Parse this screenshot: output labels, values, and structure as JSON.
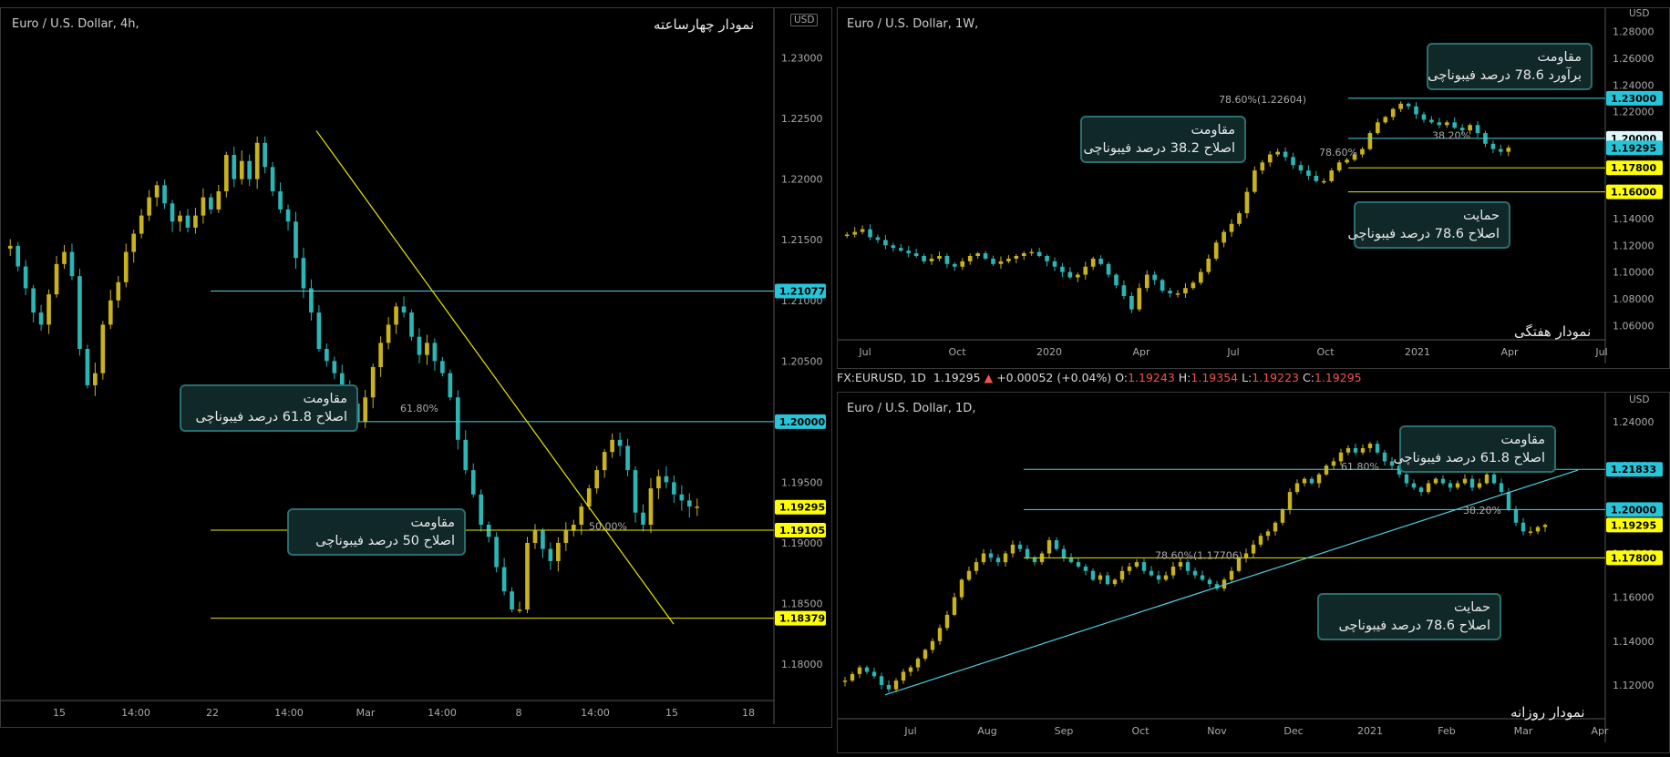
{
  "panels": {
    "left": {
      "title": "Euro / U.S. Dollar, 4h,",
      "fa_title": "نمودار چهارساعته",
      "currency": "USD",
      "y_ticks": [
        "1.23000",
        "1.22500",
        "1.22000",
        "1.21500",
        "1.21000",
        "1.20500",
        "1.20000",
        "1.19500",
        "1.19000",
        "1.18500",
        "1.18000"
      ],
      "x_ticks": [
        "15",
        "14:00",
        "22",
        "14:00",
        "Mar",
        "14:00",
        "8",
        "14:00",
        "15",
        "18"
      ],
      "price_boxes": [
        {
          "label": "1.21077",
          "bg": "#26c6da",
          "fg": "#000000"
        },
        {
          "label": "1.20000",
          "bg": "#26c6da",
          "fg": "#000000"
        },
        {
          "label": "1.19295",
          "bg": "#ffff00",
          "fg": "#000000"
        },
        {
          "label": "1.19105",
          "bg": "#ffff00",
          "fg": "#000000"
        },
        {
          "label": "1.18379",
          "bg": "#ffff00",
          "fg": "#000000"
        }
      ],
      "fib_labels": [
        "61.80%",
        "50.00%"
      ],
      "callouts": [
        {
          "line1": "مقاومت",
          "line2": "اصلاح 61.8 درصد فیبوناچی"
        },
        {
          "line1": "مقاومت",
          "line2": "اصلاح 50 درصد فیبوناچی"
        }
      ]
    },
    "weekly": {
      "title": "Euro / U.S. Dollar, 1W,",
      "fa_title": "نمودار هفتگی",
      "currency": "USD",
      "y_ticks": [
        "1.28000",
        "1.26000",
        "1.24000",
        "1.22000",
        "1.20000",
        "1.18000",
        "1.16000",
        "1.14000",
        "1.12000",
        "1.10000",
        "1.08000",
        "1.06000"
      ],
      "x_ticks": [
        "Jul",
        "Oct",
        "2020",
        "Apr",
        "Jul",
        "Oct",
        "2021",
        "Apr",
        "Jul"
      ],
      "price_boxes": [
        {
          "label": "1.23000",
          "bg": "#26c6da",
          "fg": "#000000"
        },
        {
          "label": "1.20000",
          "bg": "#e0f7fa",
          "fg": "#000000"
        },
        {
          "label": "1.19295",
          "bg": "#26c6da",
          "fg": "#000000"
        },
        {
          "label": "1.17800",
          "bg": "#ffff00",
          "fg": "#000000"
        },
        {
          "label": "1.16000",
          "bg": "#ffff00",
          "fg": "#000000"
        }
      ],
      "fib_labels": [
        "78.60%(1.22604)",
        "38.20%",
        "78.60%"
      ],
      "callouts": [
        {
          "line1": "مقاومت",
          "line2": "برآورد 78.6 درصد فیبوناچی"
        },
        {
          "line1": "مقاومت",
          "line2": "اصلاح 38.2 درصد فیبوناچی"
        },
        {
          "line1": "حمایت",
          "line2": "اصلاح 78.6 درصد فیبوناچی"
        }
      ]
    },
    "infobar": {
      "symbol": "FX:EURUSD, 1D",
      "last": "1.19295",
      "arrow": "▲",
      "change": "+0.00052 (+0.04%)",
      "o_label": "O:",
      "o": "1.19243",
      "h_label": "H:",
      "h": "1.19354",
      "l_label": "L:",
      "l": "1.19223",
      "c_label": "C:",
      "c": "1.19295"
    },
    "daily": {
      "title": "Euro / U.S. Dollar, 1D,",
      "fa_title": "نمودار روزانه",
      "currency": "USD",
      "y_ticks": [
        "1.24000",
        "1.22000",
        "1.20000",
        "1.18000",
        "1.16000",
        "1.14000",
        "1.12000"
      ],
      "x_ticks": [
        "Jul",
        "Aug",
        "Sep",
        "Oct",
        "Nov",
        "Dec",
        "2021",
        "Feb",
        "Mar",
        "Apr"
      ],
      "price_boxes": [
        {
          "label": "1.21833",
          "bg": "#26c6da",
          "fg": "#000000"
        },
        {
          "label": "1.20000",
          "bg": "#26c6da",
          "fg": "#000000"
        },
        {
          "label": "1.19295",
          "bg": "#ffff00",
          "fg": "#000000"
        },
        {
          "label": "1.17800",
          "bg": "#ffff00",
          "fg": "#000000"
        }
      ],
      "fib_labels": [
        "61.80%",
        "38.20%",
        "78.60%(1.17706)"
      ],
      "callouts": [
        {
          "line1": "مقاومت",
          "line2": "اصلاح 61.8 درصد فیبوناچی"
        },
        {
          "line1": "حمایت",
          "line2": "اصلاح 78.6 درصد فیبوناچی"
        }
      ]
    }
  },
  "chart_data": [
    {
      "type": "candlestick",
      "title": "Euro / U.S. Dollar, 4h,",
      "ylim": [
        1.177,
        1.2335
      ],
      "levels": [
        1.21077,
        1.2,
        1.19105,
        1.18379
      ],
      "last": 1.19295,
      "trendline": [
        [
          1.224,
          1.1833
        ]
      ],
      "path": [
        1.2145,
        1.2128,
        1.211,
        1.209,
        1.208,
        1.2105,
        1.213,
        1.214,
        1.212,
        1.206,
        1.203,
        1.204,
        1.208,
        1.21,
        1.2115,
        1.214,
        1.2155,
        1.217,
        1.2185,
        1.2195,
        1.218,
        1.2165,
        1.217,
        1.216,
        1.217,
        1.2185,
        1.2175,
        1.219,
        1.222,
        1.22,
        1.2215,
        1.22,
        1.223,
        1.221,
        1.219,
        1.2175,
        1.2165,
        1.2135,
        1.211,
        1.209,
        1.206,
        1.205,
        1.204,
        1.203,
        1.2015,
        1.2,
        1.202,
        1.2045,
        1.2065,
        1.208,
        1.2095,
        1.209,
        1.207,
        1.2055,
        1.2065,
        1.205,
        1.204,
        1.202,
        1.1985,
        1.196,
        1.194,
        1.1915,
        1.1905,
        1.188,
        1.186,
        1.1845,
        1.1845,
        1.19,
        1.191,
        1.1895,
        1.1885,
        1.19,
        1.191,
        1.1915,
        1.193,
        1.1945,
        1.196,
        1.1975,
        1.1985,
        1.198,
        1.196,
        1.1925,
        1.1915,
        1.1945,
        1.1955,
        1.195,
        1.194,
        1.1935,
        1.193,
        1.193
      ],
      "x_ticks": [
        "15",
        "14:00",
        "22",
        "14:00",
        "Mar",
        "14:00",
        "8",
        "14:00",
        "15",
        "18"
      ]
    },
    {
      "type": "candlestick",
      "title": "Euro / U.S. Dollar, 1W,",
      "ylim": [
        1.052,
        1.292
      ],
      "levels": [
        1.23,
        1.2,
        1.178,
        1.16
      ],
      "last": 1.19295,
      "path": [
        1.128,
        1.13,
        1.132,
        1.126,
        1.124,
        1.12,
        1.118,
        1.116,
        1.114,
        1.112,
        1.108,
        1.11,
        1.112,
        1.106,
        1.104,
        1.108,
        1.112,
        1.114,
        1.11,
        1.106,
        1.108,
        1.11,
        1.112,
        1.114,
        1.115,
        1.112,
        1.108,
        1.104,
        1.1,
        1.096,
        1.098,
        1.104,
        1.11,
        1.106,
        1.098,
        1.09,
        1.082,
        1.072,
        1.088,
        1.098,
        1.094,
        1.086,
        1.084,
        1.084,
        1.088,
        1.092,
        1.1,
        1.11,
        1.122,
        1.13,
        1.136,
        1.144,
        1.16,
        1.176,
        1.182,
        1.188,
        1.19,
        1.186,
        1.18,
        1.176,
        1.172,
        1.168,
        1.168,
        1.176,
        1.182,
        1.184,
        1.188,
        1.192,
        1.204,
        1.212,
        1.216,
        1.222,
        1.226,
        1.224,
        1.218,
        1.214,
        1.212,
        1.21,
        1.212,
        1.208,
        1.206,
        1.21,
        1.204,
        1.196,
        1.192,
        1.19,
        1.193
      ],
      "x_ticks": [
        "Jul",
        "Oct",
        "2020",
        "Apr",
        "Jul",
        "Oct",
        "2021",
        "Apr",
        "Jul"
      ]
    },
    {
      "type": "candlestick",
      "title": "Euro / U.S. Dollar, 1D,",
      "ylim": [
        1.11,
        1.25
      ],
      "levels": [
        1.21833,
        1.2,
        1.178
      ],
      "last": 1.19295,
      "trendline": [
        [
          1.1155,
          1.218
        ]
      ],
      "path": [
        1.122,
        1.125,
        1.128,
        1.126,
        1.124,
        1.12,
        1.118,
        1.122,
        1.126,
        1.128,
        1.132,
        1.136,
        1.14,
        1.146,
        1.152,
        1.16,
        1.168,
        1.172,
        1.176,
        1.18,
        1.178,
        1.176,
        1.18,
        1.184,
        1.182,
        1.178,
        1.176,
        1.18,
        1.186,
        1.182,
        1.178,
        1.176,
        1.174,
        1.172,
        1.168,
        1.17,
        1.166,
        1.168,
        1.172,
        1.174,
        1.176,
        1.172,
        1.17,
        1.168,
        1.17,
        1.174,
        1.176,
        1.172,
        1.17,
        1.168,
        1.166,
        1.164,
        1.168,
        1.172,
        1.178,
        1.18,
        1.184,
        1.188,
        1.19,
        1.194,
        1.2,
        1.208,
        1.212,
        1.214,
        1.212,
        1.216,
        1.22,
        1.222,
        1.226,
        1.228,
        1.226,
        1.228,
        1.23,
        1.226,
        1.222,
        1.22,
        1.216,
        1.212,
        1.21,
        1.208,
        1.212,
        1.214,
        1.212,
        1.21,
        1.212,
        1.214,
        1.21,
        1.212,
        1.216,
        1.212,
        1.208,
        1.2,
        1.194,
        1.19,
        1.19,
        1.192,
        1.193
      ],
      "x_ticks": [
        "Jul",
        "Aug",
        "Sep",
        "Oct",
        "Nov",
        "Dec",
        "2021",
        "Feb",
        "Mar",
        "Apr"
      ]
    }
  ]
}
